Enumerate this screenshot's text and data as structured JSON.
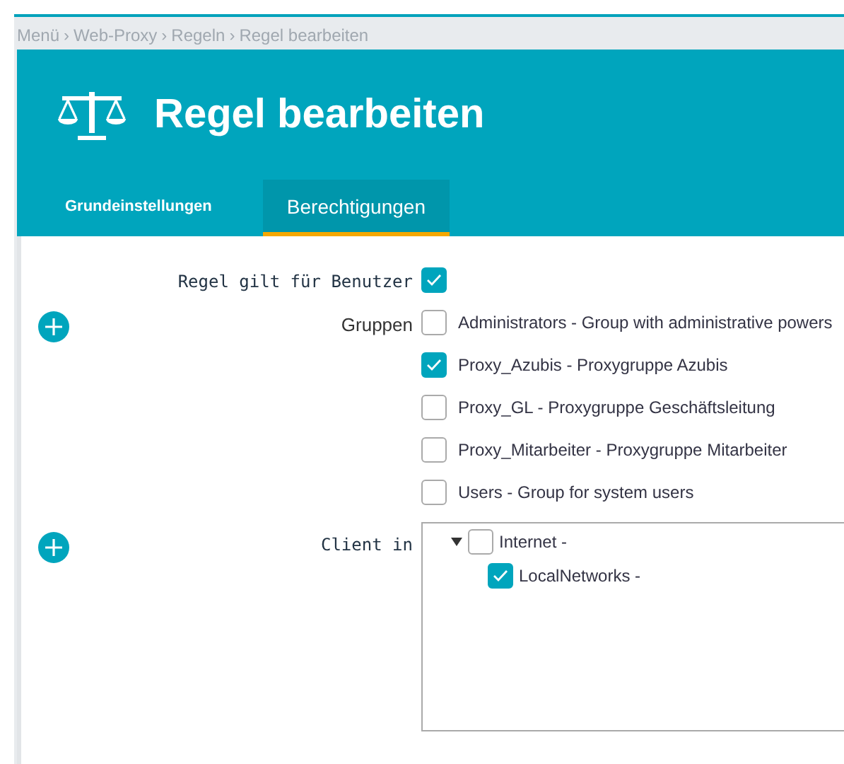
{
  "breadcrumb": [
    "Menü",
    "Web-Proxy",
    "Regeln",
    "Regel bearbeiten"
  ],
  "breadcrumb_separator": "›",
  "title": "Regel bearbeiten",
  "tabs": [
    {
      "label": "Grundeinstellungen",
      "selected": false
    },
    {
      "label": "Berechtigungen",
      "selected": true
    }
  ],
  "rule_applies": {
    "label": "Regel gilt für Benutzer",
    "checked": true
  },
  "groups": {
    "label": "Gruppen",
    "items": [
      {
        "label": "Administrators - Group with administrative powers",
        "checked": false
      },
      {
        "label": "Proxy_Azubis - Proxygruppe Azubis",
        "checked": true
      },
      {
        "label": "Proxy_GL - Proxygruppe Geschäftsleitung",
        "checked": false
      },
      {
        "label": "Proxy_Mitarbeiter - Proxygruppe Mitarbeiter",
        "checked": false
      },
      {
        "label": "Users - Group for system users",
        "checked": false
      }
    ]
  },
  "client_in": {
    "label": "Client in",
    "tree": [
      {
        "label": "Internet -",
        "checked": false,
        "expanded": true,
        "children": [
          {
            "label": "LocalNetworks -",
            "checked": true
          }
        ]
      }
    ]
  }
}
